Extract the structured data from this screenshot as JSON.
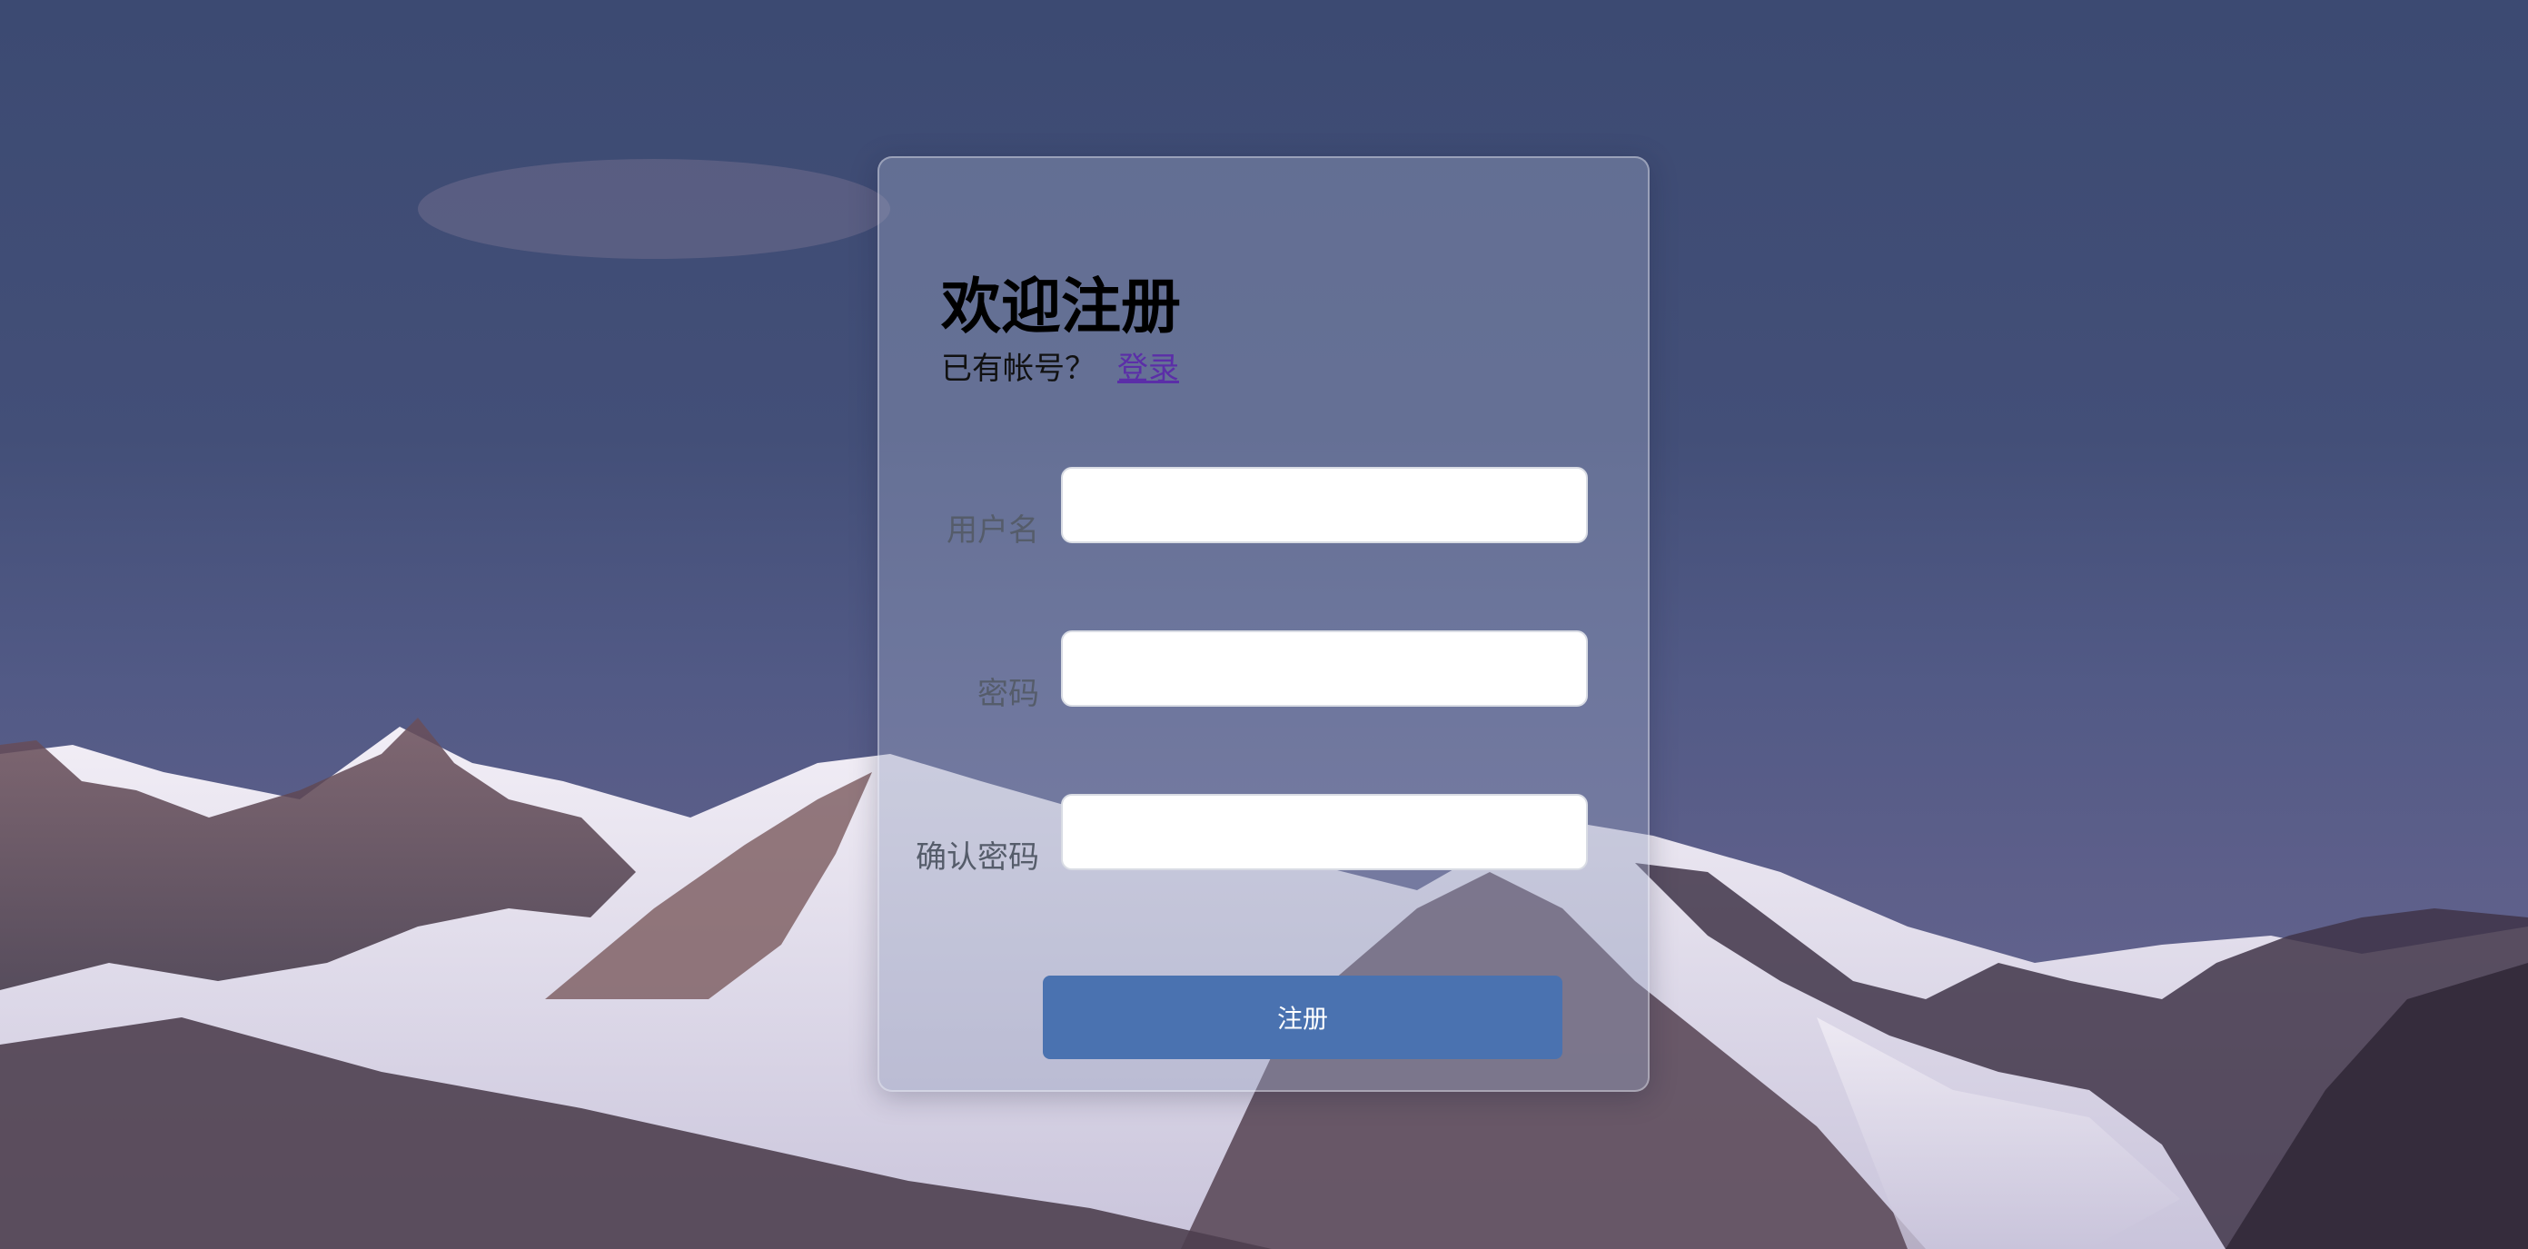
{
  "form": {
    "title": "欢迎注册",
    "has_account_text": "已有帐号？",
    "login_link": "登录",
    "fields": [
      {
        "label": "用户名",
        "value": "",
        "placeholder": ""
      },
      {
        "label": "密码",
        "value": "",
        "placeholder": ""
      },
      {
        "label": "确认密码",
        "value": "",
        "placeholder": ""
      }
    ],
    "submit_label": "注册"
  },
  "colors": {
    "button": "#4a72b0",
    "link": "#5b2ea8"
  }
}
